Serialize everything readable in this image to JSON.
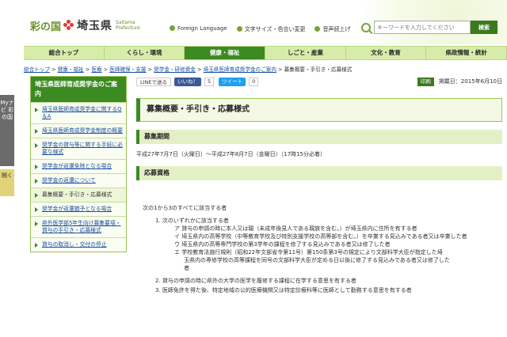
{
  "header": {
    "logo_sai": "彩の国",
    "logo_pref": "埼玉県",
    "logo_roman_1": "Saitama",
    "logo_roman_2": "Prefecture",
    "links": [
      "Foreign Language",
      "文字サイズ・色合い変更",
      "音声読上げ"
    ],
    "search_placeholder": "キーワードを入力してください",
    "search_button": "検索"
  },
  "nav": [
    "総合トップ",
    "くらし・環境",
    "健康・福祉",
    "しごと・産業",
    "文化・教育",
    "県政情報・統計"
  ],
  "breadcrumb": {
    "links": [
      "総合トップ",
      "健康・福祉",
      "医療",
      "医師確保・支援",
      "奨学金・研修資金",
      "埼玉県医師育成奨学金のご案内"
    ],
    "sep": " > ",
    "current": "募集概要・手引き・応募様式"
  },
  "mynavi": {
    "label": "Myナビ 彩の国",
    "button": "開く"
  },
  "sidebar": {
    "title": "埼玉県医師育成奨学金のご案内",
    "items": [
      "埼玉県医師育成奨学金に関するQ＆A",
      "埼玉県医師育成奨学金制度の概要",
      "奨学金の貸与等に関する手続に必要な様式",
      "奨学金が返還免除となる場合",
      "奨学金の返還について",
      "募集概要・手引き・応募様式",
      "奨学金が返還猶予となる場合",
      "県外医学部5年生向け募集要項・貸与の手引き・応募様式",
      "貸与の取消し・交付の停止"
    ]
  },
  "share": {
    "line": "LINEで送る",
    "facebook": "いいね！",
    "facebook_count": "5",
    "twitter": "ツイート",
    "twitter_count": "0",
    "print": "印刷",
    "published": "掲載日：2015年6月10日"
  },
  "main": {
    "title": "募集概要・手引き・応募様式",
    "section1_title": "募集期間",
    "period": "平成27年7月7日（火曜日）～平成27年8月7日（金曜日）（17時15分必着）",
    "section2_title": "応募資格",
    "intro": "次の1から3のすべてに該当する者",
    "item1": "1.  次のいずれかに該当する者",
    "item1_a": "ア  貸与の申請の時に本人又は親（未成年後見人である親族を含む。）が埼玉県内に住所を有する者",
    "item1_i": "イ  埼玉県内の高等学校（中等教育学校及び特別支援学校の高等部を含む。）を卒業する見込みである者又は卒業した者",
    "item1_u": "ウ  埼玉県内の高等専門学校の第3学年の課程を修了する見込みである者又は修了した者",
    "item1_e": "エ  学校教育法施行規則（昭和22年文部省令第11号）第150条第3号の規定により文部科学大臣が指定した埼",
    "item1_e2": "玉県内の専修学校の高等課程を同号の文部科学大臣が定める日以後に修了する見込みである者又は修了した",
    "item1_e3": "者",
    "item2": "2.  貸与の申請の時に県外の大学の医学を履修する課程に在学する意思を有する者",
    "item3": "3.  医師免許を得た後、特定地域の公的医療機関又は特定診療科等に医師として勤務する意思を有する者"
  }
}
